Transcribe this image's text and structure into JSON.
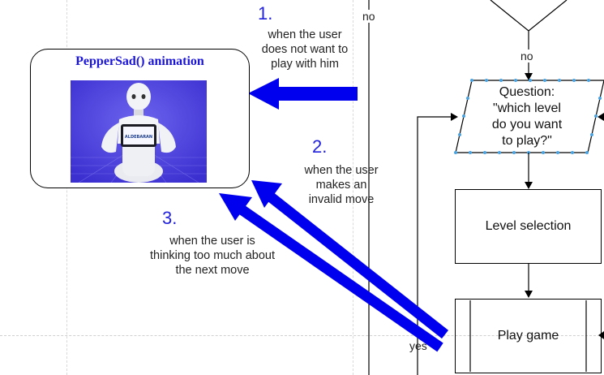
{
  "card": {
    "title": "PepperSad() animation",
    "tablet_logo": "ALDEBARAN"
  },
  "annotations": [
    {
      "number": "1.",
      "lines": [
        "when the user",
        "does not want to",
        "play with him"
      ]
    },
    {
      "number": "2.",
      "lines": [
        "when the user",
        "makes an",
        "invalid move"
      ]
    },
    {
      "number": "3.",
      "lines": [
        "when the user is",
        "thinking too much about",
        "the next move"
      ]
    }
  ],
  "flow": {
    "no_top": "no",
    "no_decision": "no",
    "question_lines": [
      "Question:",
      "\"which level",
      "do you want",
      "to play?\""
    ],
    "level_selection": "Level selection",
    "play_game": "Play game",
    "yes": "yes"
  },
  "colors": {
    "arrow_blue": "#0000ee",
    "title_blue": "#1a14d6",
    "selection_handle": "#4aa3e0",
    "photo_bg": "#5a4be0"
  }
}
